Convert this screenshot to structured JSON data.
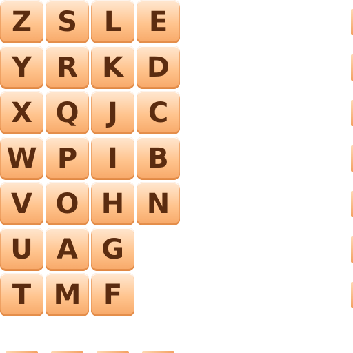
{
  "board": {
    "rows": [
      [
        "Z",
        "S",
        "L",
        "E"
      ],
      [
        "Y",
        "R",
        "K",
        "D"
      ],
      [
        "X",
        "Q",
        "J",
        "C"
      ],
      [
        "W",
        "P",
        "I",
        "B"
      ],
      [
        "V",
        "O",
        "H",
        "N"
      ],
      [
        "U",
        "A",
        "G",
        ""
      ],
      [
        "T",
        "M",
        "F",
        ""
      ]
    ]
  },
  "colors": {
    "tile_light": "#ffe8d2",
    "tile_mid": "#ffc48e",
    "tile_dark": "#f7a767",
    "letter": "#5b2c10",
    "background": "#ffffff"
  }
}
